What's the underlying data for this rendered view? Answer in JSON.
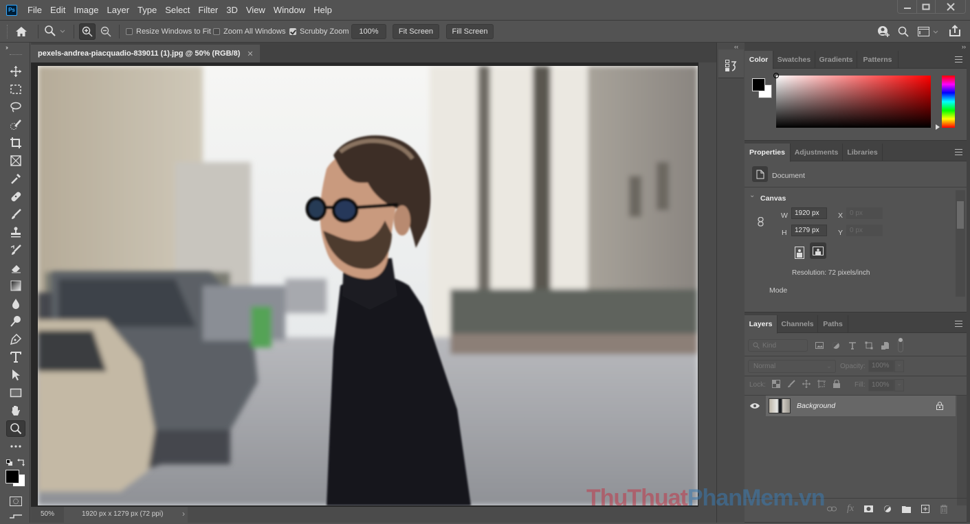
{
  "app": {
    "name": "Adobe Photoshop",
    "logo": "Ps"
  },
  "menu": [
    "File",
    "Edit",
    "Image",
    "Layer",
    "Type",
    "Select",
    "Filter",
    "3D",
    "View",
    "Window",
    "Help"
  ],
  "window_controls": {
    "minimize": "—",
    "maximize": "□",
    "close": "✕"
  },
  "options_bar": {
    "resize_windows": {
      "label": "Resize Windows to Fit",
      "checked": false
    },
    "zoom_all": {
      "label": "Zoom All Windows",
      "checked": false
    },
    "scrubby_zoom": {
      "label": "Scrubby Zoom",
      "checked": true
    },
    "zoom_100": "100%",
    "fit_screen": "Fit Screen",
    "fill_screen": "Fill Screen"
  },
  "tools": [
    "move",
    "rectangular-marquee",
    "lasso",
    "quick-selection",
    "crop",
    "frame",
    "eyedropper",
    "healing-brush",
    "brush",
    "clone-stamp",
    "history-brush",
    "eraser",
    "gradient",
    "blur",
    "dodge",
    "pen",
    "type",
    "path-selection",
    "rectangle",
    "hand",
    "zoom",
    "more-tools"
  ],
  "active_tool": "zoom",
  "colors": {
    "foreground": "#000000",
    "background": "#ffffff",
    "accent": "#31a8ff"
  },
  "document": {
    "tab_title": "pexels-andrea-piacquadio-839011 (1).jpg @ 50% (RGB/8)",
    "zoom": "50%",
    "info": "1920 px x 1279 px (72 ppi)"
  },
  "color_panel": {
    "tabs": [
      "Color",
      "Swatches",
      "Gradients",
      "Patterns"
    ],
    "active": "Color"
  },
  "properties_panel": {
    "tabs": [
      "Properties",
      "Adjustments",
      "Libraries"
    ],
    "active": "Properties",
    "doc_label": "Document",
    "section": "Canvas",
    "w_label": "W",
    "w_value": "1920 px",
    "h_label": "H",
    "h_value": "1279 px",
    "x_label": "X",
    "x_value": "0 px",
    "y_label": "Y",
    "y_value": "0 px",
    "resolution": "Resolution: 72 pixels/inch",
    "mode_label": "Mode"
  },
  "layers_panel": {
    "tabs": [
      "Layers",
      "Channels",
      "Paths"
    ],
    "active": "Layers",
    "filter_kind": "Kind",
    "blend_mode": "Normal",
    "opacity_label": "Opacity:",
    "opacity_value": "100%",
    "lock_label": "Lock:",
    "fill_label": "Fill:",
    "fill_value": "100%",
    "layers": [
      {
        "name": "Background",
        "visible": true,
        "locked": true
      }
    ]
  },
  "watermark": {
    "part1": "ThuThuat",
    "part2": "PhanMem",
    "part3": ".vn"
  }
}
